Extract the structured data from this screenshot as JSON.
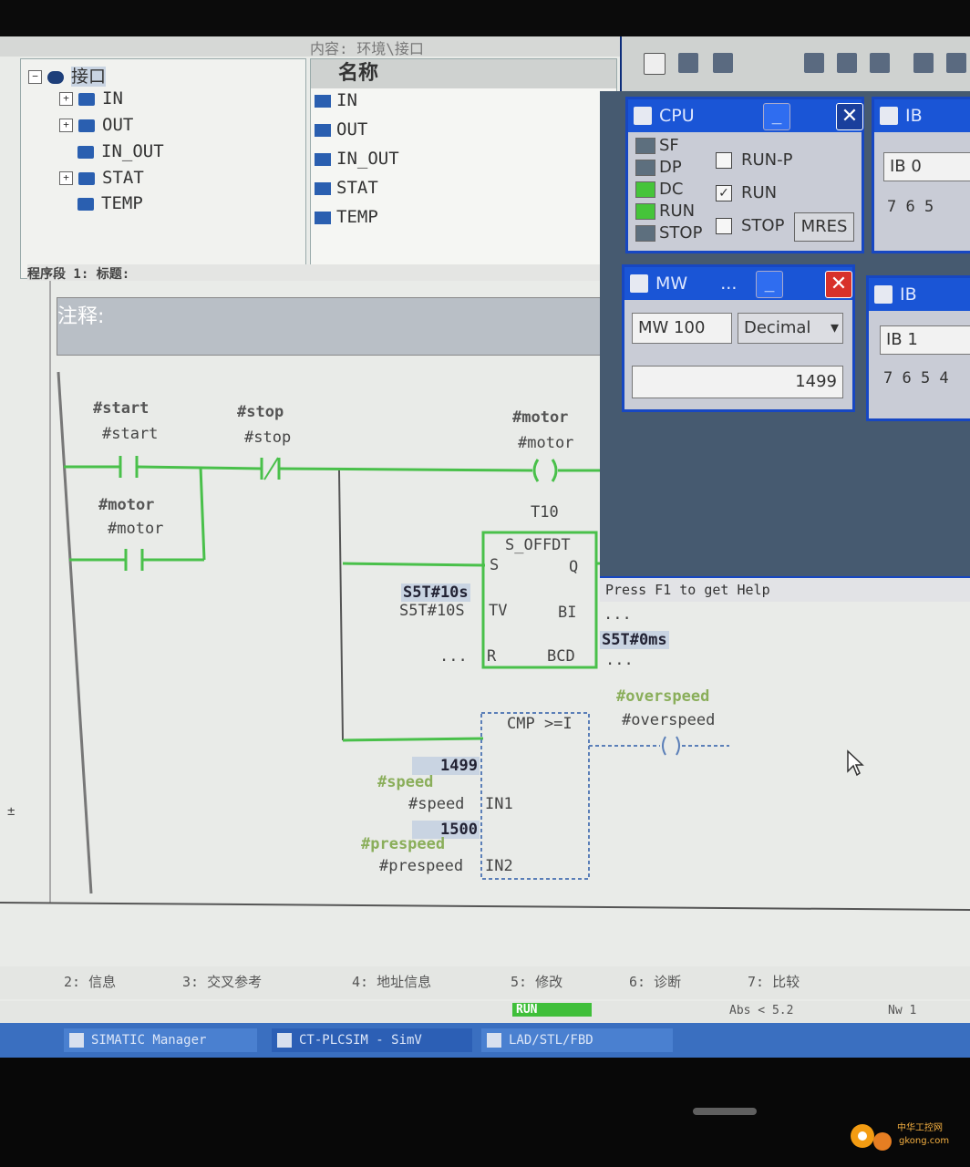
{
  "window": {
    "top_strip_text": "内容: 环境\\接口"
  },
  "tree": {
    "root": "接口",
    "items": [
      {
        "label": "IN",
        "expand": "+"
      },
      {
        "label": "OUT",
        "expand": "+"
      },
      {
        "label": "IN_OUT",
        "expand": ""
      },
      {
        "label": "STAT",
        "expand": "+"
      },
      {
        "label": "TEMP",
        "expand": ""
      }
    ]
  },
  "list": {
    "header": "名称",
    "items": [
      "IN",
      "OUT",
      "IN_OUT",
      "STAT",
      "TEMP"
    ]
  },
  "network": {
    "bar": "程序段 1: 标题:",
    "comment_label": "注释:"
  },
  "ladder": {
    "start_top": "#start",
    "start_bottom": "#start",
    "stop_top": "#stop",
    "stop_bottom": "#stop",
    "motor_coil_top": "#motor",
    "motor_coil_bottom": "#motor",
    "motor_contact_top": "#motor",
    "motor_contact_bottom": "#motor",
    "timer_name": "T10",
    "timer_type": "S_OFFDT",
    "timer_pins": {
      "s": "S",
      "q": "Q",
      "tv": "TV",
      "bi": "BI",
      "r": "R",
      "bcd": "BCD"
    },
    "tv_status": "S5T#10s",
    "tv_param": "S5T#10S",
    "r_param": "...",
    "bi_out": "...",
    "bcd_status": "S5T#0ms",
    "bcd_out": "...",
    "cmp_type": "CMP >=I",
    "cmp_pins": {
      "in1": "IN1",
      "in2": "IN2"
    },
    "speed_value": "1499",
    "speed_status": "#speed",
    "speed_param": "#speed",
    "prespeed_value": "1500",
    "prespeed_status": "#prespeed",
    "prespeed_param": "#prespeed",
    "overspeed_status": "#overspeed",
    "overspeed_param": "#overspeed"
  },
  "tabs": [
    "2: 信息",
    "3: 交叉参考",
    "4: 地址信息",
    "5: 修改",
    "6: 诊断",
    "7: 比较"
  ],
  "status": {
    "mode": "RUN",
    "abs": "Abs < 5.2",
    "nw": "Nw 1"
  },
  "taskbar": [
    "SIMATIC Manager",
    "CT-PLCSIM - SimV",
    "LAD/STL/FBD"
  ],
  "cpu_window": {
    "title": "CPU",
    "leds": [
      {
        "label": "SF",
        "color": "#5d6f7e"
      },
      {
        "label": "DP",
        "color": "#5d6f7e"
      },
      {
        "label": "DC",
        "color": "#45c43a"
      },
      {
        "label": "RUN",
        "color": "#45c43a"
      },
      {
        "label": "STOP",
        "color": "#5d6f7e"
      }
    ],
    "run_p": "RUN-P",
    "run": "RUN",
    "stop": "STOP",
    "mres": "MRES",
    "run_checked": "✓"
  },
  "mw_window": {
    "title": "MW",
    "dots": "...",
    "address": "MW  100",
    "format": "Decimal",
    "value": "1499"
  },
  "ib_windows": [
    {
      "title": "IB",
      "address": "IB    0",
      "bits": "7  6  5"
    },
    {
      "title": "IB",
      "address": "IB    1",
      "bits": "7  6  5  4"
    }
  ],
  "help": "Press F1 to get Help",
  "watermark": "中华工控网 gkong.com"
}
